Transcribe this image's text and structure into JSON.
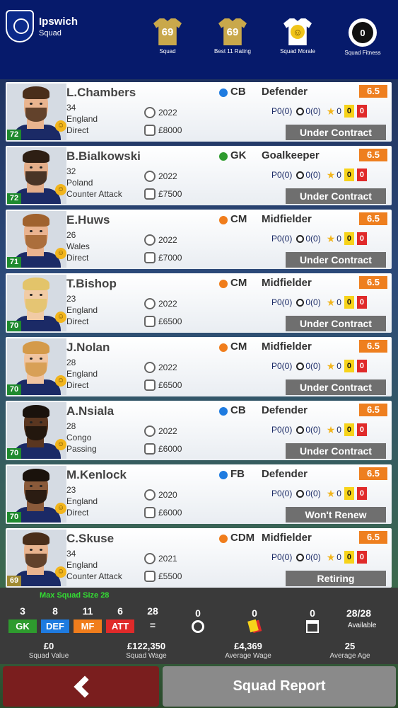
{
  "club": {
    "name": "Ipswich",
    "subtitle": "Squad"
  },
  "header_stats": [
    {
      "value": "69",
      "label": "Squad"
    },
    {
      "value": "69",
      "label": "Best 11 Rating"
    },
    {
      "value": "",
      "label": "Squad Morale"
    },
    {
      "value": "0",
      "label": "Squad Fitness"
    }
  ],
  "players": [
    {
      "name": "L.Chambers",
      "age": "34",
      "nation": "England",
      "style": "Direct",
      "pos": "CB",
      "pos_color": "#1e7be0",
      "role": "Defender",
      "rating": "6.5",
      "overall": "72",
      "contract": "2022",
      "wage": "£8000",
      "p": "P0(0)",
      "goals": "0(0)",
      "stars": "0",
      "yellow": "0",
      "red": "0",
      "status": "Under Contract",
      "skin": "#e9b48f",
      "hair": "#4a2e1a"
    },
    {
      "name": "B.Bialkowski",
      "age": "32",
      "nation": "Poland",
      "style": "Counter Attack",
      "pos": "GK",
      "pos_color": "#2e9b2e",
      "role": "Goalkeeper",
      "rating": "6.5",
      "overall": "72",
      "contract": "2022",
      "wage": "£7500",
      "p": "P0(0)",
      "goals": "0(0)",
      "stars": "0",
      "yellow": "0",
      "red": "0",
      "status": "Under Contract",
      "skin": "#e4ae8a",
      "hair": "#2e1f14"
    },
    {
      "name": "E.Huws",
      "age": "26",
      "nation": "Wales",
      "style": "Direct",
      "pos": "CM",
      "pos_color": "#f07d1c",
      "role": "Midfielder",
      "rating": "6.5",
      "overall": "71",
      "contract": "2022",
      "wage": "£7000",
      "p": "P0(0)",
      "goals": "0(0)",
      "stars": "0",
      "yellow": "0",
      "red": "0",
      "status": "Under Contract",
      "skin": "#eab38f",
      "hair": "#a0622e"
    },
    {
      "name": "T.Bishop",
      "age": "23",
      "nation": "England",
      "style": "Direct",
      "pos": "CM",
      "pos_color": "#f07d1c",
      "role": "Midfielder",
      "rating": "6.5",
      "overall": "70",
      "contract": "2022",
      "wage": "£6500",
      "p": "P0(0)",
      "goals": "0(0)",
      "stars": "0",
      "yellow": "0",
      "red": "0",
      "status": "Under Contract",
      "skin": "#f1cba5",
      "hair": "#e3c46a"
    },
    {
      "name": "J.Nolan",
      "age": "28",
      "nation": "England",
      "style": "Direct",
      "pos": "CM",
      "pos_color": "#f07d1c",
      "role": "Midfielder",
      "rating": "6.5",
      "overall": "70",
      "contract": "2022",
      "wage": "£6500",
      "p": "P0(0)",
      "goals": "0(0)",
      "stars": "0",
      "yellow": "0",
      "red": "0",
      "status": "Under Contract",
      "skin": "#f0c4a0",
      "hair": "#d49a4a"
    },
    {
      "name": "A.Nsiala",
      "age": "28",
      "nation": "Congo",
      "style": "Passing",
      "pos": "CB",
      "pos_color": "#1e7be0",
      "role": "Defender",
      "rating": "6.5",
      "overall": "70",
      "contract": "2022",
      "wage": "£6000",
      "p": "P0(0)",
      "goals": "0(0)",
      "stars": "0",
      "yellow": "0",
      "red": "0",
      "status": "Under Contract",
      "skin": "#5a3620",
      "hair": "#1a120c"
    },
    {
      "name": "M.Kenlock",
      "age": "23",
      "nation": "England",
      "style": "Direct",
      "pos": "FB",
      "pos_color": "#1e7be0",
      "role": "Defender",
      "rating": "6.5",
      "overall": "70",
      "contract": "2020",
      "wage": "£6000",
      "p": "P0(0)",
      "goals": "0(0)",
      "stars": "0",
      "yellow": "0",
      "red": "0",
      "status": "Won't Renew",
      "skin": "#8a5a3a",
      "hair": "#1a120c"
    },
    {
      "name": "C.Skuse",
      "age": "34",
      "nation": "England",
      "style": "Counter Attack",
      "pos": "CDM",
      "pos_color": "#f07d1c",
      "role": "Midfielder",
      "rating": "6.5",
      "overall": "69",
      "contract": "2021",
      "wage": "£5500",
      "p": "P0(0)",
      "goals": "0(0)",
      "stars": "0",
      "yellow": "0",
      "red": "0",
      "status": "Retiring",
      "skin": "#e9b48f",
      "hair": "#4a2e1a"
    }
  ],
  "summary": {
    "max_squad": "Max Squad Size 28",
    "counts": [
      {
        "value": "3",
        "label": "GK",
        "color": "#2e9b2e"
      },
      {
        "value": "8",
        "label": "DEF",
        "color": "#1e7be0"
      },
      {
        "value": "11",
        "label": "MF",
        "color": "#f07d1c"
      },
      {
        "value": "6",
        "label": "ATT",
        "color": "#e02a2a"
      }
    ],
    "total": "28",
    "total_sign": "=",
    "injured": "0",
    "suspended": "0",
    "unavailable": "0",
    "available_value": "28/28",
    "available_label": "Available",
    "finance": [
      {
        "value": "£0",
        "label": "Squad Value"
      },
      {
        "value": "£122,350",
        "label": "Squad Wage"
      },
      {
        "value": "£4,369",
        "label": "Average Wage"
      },
      {
        "value": "25",
        "label": "Average Age"
      }
    ]
  },
  "buttons": {
    "report": "Squad Report"
  }
}
